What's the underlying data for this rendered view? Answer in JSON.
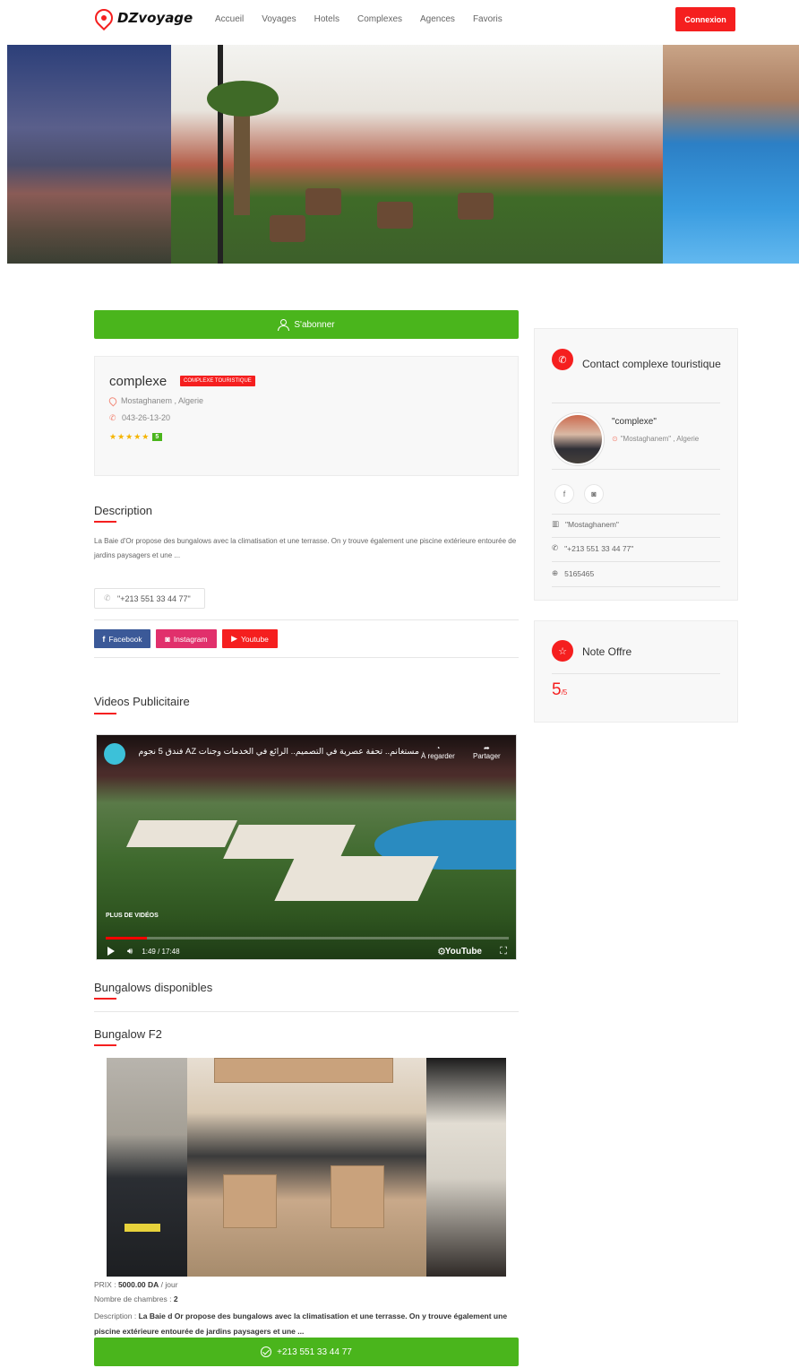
{
  "brand": {
    "name": "DZvoyage",
    "accent": "#f51f1f",
    "green": "#4ab51c"
  },
  "nav": {
    "items": [
      "Accueil",
      "Voyages",
      "Hotels",
      "Complexes",
      "Agences",
      "Favoris"
    ],
    "login": "Connexion"
  },
  "subscribe": {
    "label": "S'abonner"
  },
  "complex": {
    "name": "complexe",
    "type_badge": "COMPLEXE TOURISTIQUE",
    "location": "Mostaghanem , Algerie",
    "phone": "043-26-13-20",
    "stars": "★★★★★",
    "rating": "5"
  },
  "description": {
    "title": "Description",
    "text": "La Baie d'Or propose des bungalows avec la climatisation et une terrasse. On y trouve également une piscine extérieure entourée de jardins paysagers et une ..."
  },
  "phone_box": "\"+213 551 33 44 77\"",
  "social": {
    "facebook": "Facebook",
    "instagram": "Instagram",
    "youtube": "Youtube"
  },
  "videos": {
    "title": "Videos Publicitaire",
    "video_title": "مستغانم.. تحفة عصرية في التصميم.. الرائع في الخدمات وجنات AZ فندق 5 نجوم",
    "watch_later": "À regarder",
    "share": "Partager",
    "more_videos": "PLUS DE VIDÉOS",
    "time": "1:49 / 17:48",
    "progress": 0.103,
    "brand": "YouTube"
  },
  "bungalows": {
    "title": "Bungalows disponibles",
    "item_title": "Bungalow F2",
    "price_label": "PRIX : ",
    "price_value": "5000.00 DA",
    "price_unit": " / jour",
    "rooms_label": "Nombre de chambres : ",
    "rooms_value": "2",
    "desc_label": "Description : ",
    "desc_value": "La Baie d Or propose des bungalows avec la climatisation et une terrasse. On y trouve également une piscine extérieure entourée de jardins paysagers et une ...",
    "call_label": "+213 551 33 44 77"
  },
  "contact": {
    "title": "Contact complexe touristique",
    "name": "\"complexe\"",
    "location": "\"Mostaghanem\" , Algerie",
    "city": "\"Mostaghanem\"",
    "phone": "\"+213 551 33 44 77\"",
    "web": "5165465"
  },
  "note": {
    "title": "Note Offre",
    "value": "5",
    "max": "/5"
  }
}
